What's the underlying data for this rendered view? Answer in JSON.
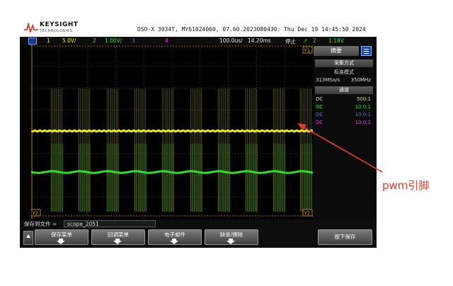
{
  "header": {
    "brand": "KEYSIGHT",
    "brand_sub": "TECHNOLOGIES",
    "device_info": "DSO-X 3034T, MY61024060, 07.60.2023080430: Thu Dec 19 14:45:50 2024"
  },
  "statusbar": {
    "ch1_num": "1",
    "ch1_scale": "5.0V/",
    "ch2_num": "2",
    "ch2_scale": "1.00V/",
    "ch3_num": "3",
    "ch4_num": "4",
    "timebase": "100.0us/",
    "delay": "14.20ms",
    "run_state": "停止",
    "trig_icon": "trigger-edge-icon",
    "trig_ch": "2",
    "trig_level": "1.18V"
  },
  "screen": {
    "marker_y1": "Y1",
    "marker_y2": "Y2",
    "marker_ch1": "1",
    "marker_ch2": "2",
    "marker_t": "T"
  },
  "panel": {
    "title": "摘要",
    "acq_head": "采集方式",
    "acq_mode": "标准模式",
    "sample_rate": "313MSa/s",
    "bandwidth": "350MHz",
    "chan_head": "通道",
    "channels": [
      {
        "coupling": "DC",
        "probe": "500:1",
        "color": "#e8e81a"
      },
      {
        "coupling": "DC",
        "probe": "10.0:1",
        "color": "#2ee02e"
      },
      {
        "coupling": "DC",
        "probe": "10.0:1",
        "color": "#3a7bff"
      },
      {
        "coupling": "DC",
        "probe": "10.0:1",
        "color": "#e040e0"
      }
    ]
  },
  "bottom": {
    "save_label": "保存到文件 =",
    "save_value": "scope_2051",
    "softkeys": [
      "保存菜单",
      "回调菜单",
      "电子邮件",
      "缺省/擦除"
    ],
    "press_save": "按下保存"
  },
  "annotation": {
    "label": "pwm引脚"
  },
  "colors": {
    "ch1": "#e8e81a",
    "ch2": "#2ee02e",
    "annotation": "#e53a2c"
  }
}
